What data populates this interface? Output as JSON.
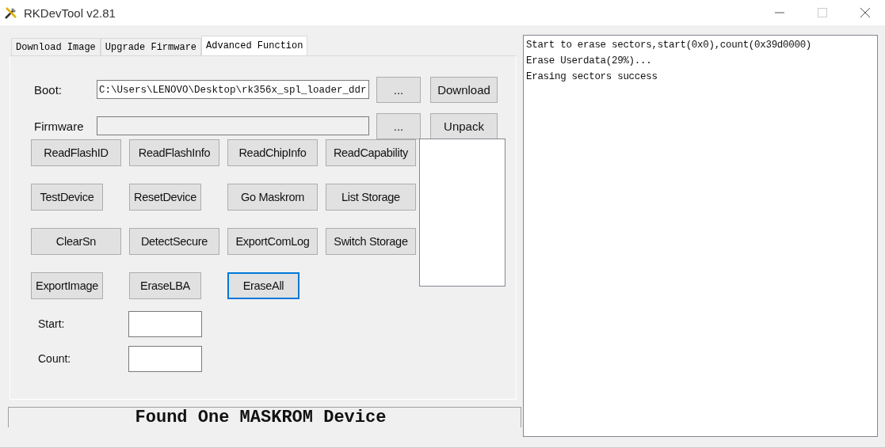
{
  "window": {
    "title": "RKDevTool v2.81"
  },
  "tabs": [
    {
      "label": "Download Image",
      "selected": false
    },
    {
      "label": "Upgrade Firmware",
      "selected": false
    },
    {
      "label": "Advanced Function",
      "selected": true
    }
  ],
  "boot": {
    "label": "Boot:",
    "value": "C:\\Users\\LENOVO\\Desktop\\rk356x_spl_loader_ddr",
    "browse": "...",
    "action": "Download"
  },
  "firmware": {
    "label": "Firmware",
    "browse": "...",
    "action": "Unpack"
  },
  "functions": [
    {
      "label": "ReadFlashID",
      "focused": false
    },
    {
      "label": "ReadFlashInfo",
      "focused": false
    },
    {
      "label": "ReadChipInfo",
      "focused": false
    },
    {
      "label": "ReadCapability",
      "focused": false
    },
    {
      "label": "TestDevice",
      "focused": false
    },
    {
      "label": "ResetDevice",
      "focused": false
    },
    {
      "label": "Go Maskrom",
      "focused": false
    },
    {
      "label": "List Storage",
      "focused": false
    },
    {
      "label": "ClearSn",
      "focused": false
    },
    {
      "label": "DetectSecure",
      "focused": false
    },
    {
      "label": "ExportComLog",
      "focused": false
    },
    {
      "label": "Switch Storage",
      "focused": false
    },
    {
      "label": "ExportImage",
      "focused": false
    },
    {
      "label": "EraseLBA",
      "focused": false
    },
    {
      "label": "EraseAll",
      "focused": true
    }
  ],
  "start": {
    "label": "Start:"
  },
  "count": {
    "label": "Count:"
  },
  "status": "Found One MASKROM Device",
  "log": [
    "Start to erase sectors,start(0x0),count(0x39d0000)",
    "Erase Userdata(29%)...",
    "Erasing sectors success"
  ]
}
